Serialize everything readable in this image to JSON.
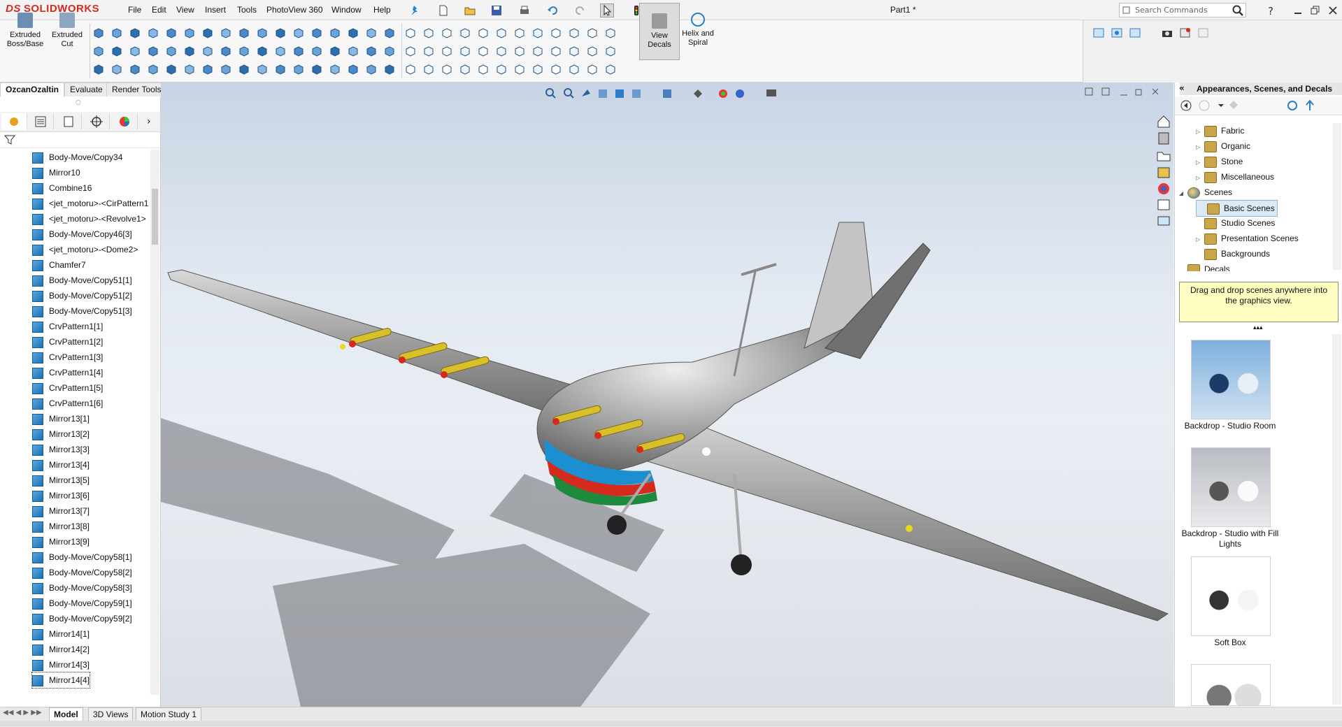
{
  "app": {
    "logo_text": "SOLIDWORKS",
    "logo_prefix": "DS",
    "document_title": "Part1 *"
  },
  "menu": [
    "File",
    "Edit",
    "View",
    "Insert",
    "Tools",
    "PhotoView 360",
    "Window",
    "Help"
  ],
  "search": {
    "placeholder": "Search Commands"
  },
  "ribbon": {
    "extruded_boss": "Extruded Boss/Base",
    "extruded_cut": "Extruded Cut",
    "view_decals": "View Decals",
    "helix_spiral": "Helix and Spiral"
  },
  "command_tabs": [
    "OzcanOzaltin",
    "Evaluate",
    "Render Tools"
  ],
  "feature_tree": [
    "Body-Move/Copy34",
    "Mirror10",
    "Combine16",
    "<jet_motoru>-<CirPattern1",
    "<jet_motoru>-<Revolve1>",
    "Body-Move/Copy46[3]",
    "<jet_motoru>-<Dome2>",
    "Chamfer7",
    "Body-Move/Copy51[1]",
    "Body-Move/Copy51[2]",
    "Body-Move/Copy51[3]",
    "CrvPattern1[1]",
    "CrvPattern1[2]",
    "CrvPattern1[3]",
    "CrvPattern1[4]",
    "CrvPattern1[5]",
    "CrvPattern1[6]",
    "Mirror13[1]",
    "Mirror13[2]",
    "Mirror13[3]",
    "Mirror13[4]",
    "Mirror13[5]",
    "Mirror13[6]",
    "Mirror13[7]",
    "Mirror13[8]",
    "Mirror13[9]",
    "Body-Move/Copy58[1]",
    "Body-Move/Copy58[2]",
    "Body-Move/Copy58[3]",
    "Body-Move/Copy59[1]",
    "Body-Move/Copy59[2]",
    "Mirror14[1]",
    "Mirror14[2]",
    "Mirror14[3]",
    "Mirror14[4]"
  ],
  "right_panel": {
    "title": "Appearances, Scenes, and Decals",
    "tree": [
      "Fabric",
      "Organic",
      "Stone",
      "Miscellaneous",
      "Scenes",
      "Basic Scenes",
      "Studio Scenes",
      "Presentation Scenes",
      "Backgrounds",
      "Decals"
    ],
    "tip": "Drag and drop scenes anywhere into the graphics view.",
    "scenes": [
      "Backdrop - Studio Room",
      "Backdrop - Studio with Fill Lights",
      "Soft Box"
    ]
  },
  "bottom_tabs": [
    "Model",
    "3D Views",
    "Motion Study 1"
  ],
  "colors": {
    "accent": "#d52b1e",
    "selection": "#dce9f7",
    "tip_bg": "#ffffc2"
  }
}
